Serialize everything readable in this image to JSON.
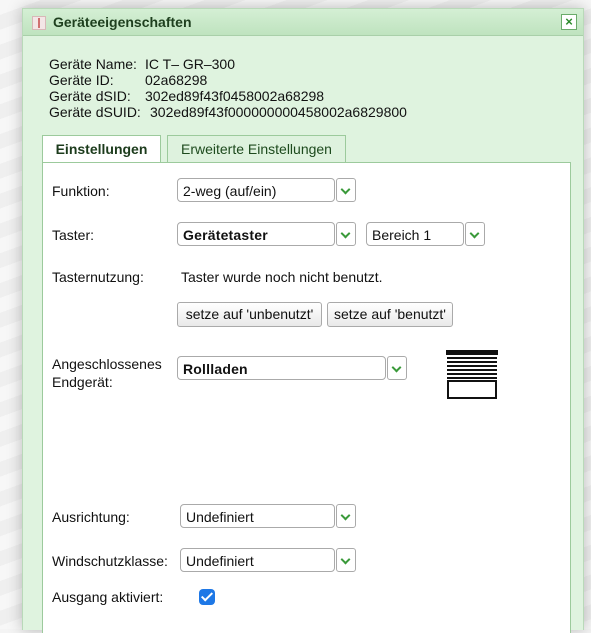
{
  "window": {
    "title": "Geräteeigenschaften",
    "close_label": "×"
  },
  "device_info": [
    {
      "label": "Geräte Name:",
      "value": "IC T– GR–300"
    },
    {
      "label": "Geräte ID:",
      "value": "02a68298"
    },
    {
      "label": "Geräte dSID:",
      "value": "302ed89f43f0458002a68298"
    },
    {
      "label": "Geräte dSUID:",
      "value": "302ed89f43f000000000458002a6829800"
    }
  ],
  "tabs": [
    {
      "label": "Einstellungen",
      "active": true
    },
    {
      "label": "Erweiterte Einstellungen",
      "active": false
    }
  ],
  "settings": {
    "funktion": {
      "label": "Funktion:",
      "value": "2-weg (auf/ein)"
    },
    "taster": {
      "label": "Taster:",
      "value": "Gerätetaster",
      "bereich": "Bereich 1"
    },
    "tasternutzung": {
      "label": "Tasternutzung:",
      "value": "Taster wurde noch nicht benutzt."
    },
    "buttons": {
      "unbenutzt": "setze auf 'unbenutzt'",
      "benutzt": "setze auf 'benutzt'"
    },
    "endgeraet": {
      "label_line1": "Angeschlossenes",
      "label_line2": "Endgerät:",
      "value": "Rollladen",
      "icon": "blind-icon"
    },
    "ausrichtung": {
      "label": "Ausrichtung:",
      "value": "Undefiniert"
    },
    "windschutz": {
      "label": "Windschutzklasse:",
      "value": "Undefiniert"
    },
    "ausgang": {
      "label": "Ausgang aktiviert:",
      "checked": true
    }
  },
  "colors": {
    "accent_green": "#3a9a3a",
    "checkbox_blue": "#1e78e6",
    "dialog_bg": "#dff3df"
  }
}
